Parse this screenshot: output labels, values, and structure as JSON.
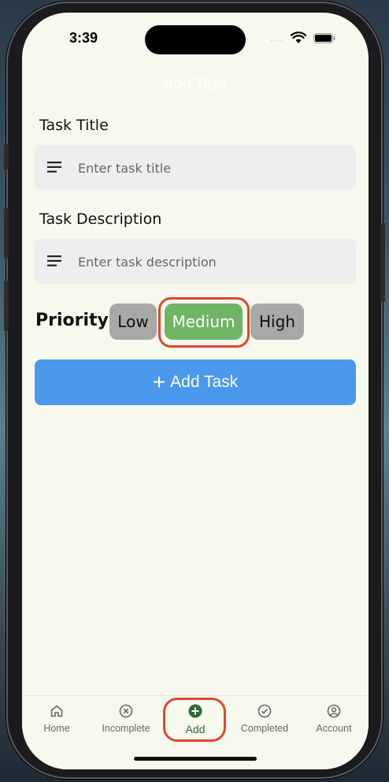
{
  "status_bar": {
    "time": "3:39",
    "signal": "....",
    "icons": [
      "wifi-icon",
      "battery-icon"
    ]
  },
  "header": {
    "title": "Add Task"
  },
  "form": {
    "title_label": "Task Title",
    "title_placeholder": "Enter task title",
    "description_label": "Task Description",
    "description_placeholder": "Enter task description",
    "priority_label": "Priority",
    "priorities": [
      {
        "label": "Low",
        "selected": false
      },
      {
        "label": "Medium",
        "selected": true
      },
      {
        "label": "High",
        "selected": false
      }
    ],
    "submit_label": "Add Task",
    "submit_icon": "+"
  },
  "bottom_nav": {
    "items": [
      {
        "label": "Home",
        "icon": "home-icon",
        "active": false
      },
      {
        "label": "Incomplete",
        "icon": "x-circle-icon",
        "active": false
      },
      {
        "label": "Add",
        "icon": "add-circle-icon",
        "active": true
      },
      {
        "label": "Completed",
        "icon": "check-circle-icon",
        "active": false
      },
      {
        "label": "Account",
        "icon": "account-icon",
        "active": false
      }
    ]
  },
  "colors": {
    "background": "#f7f9ef",
    "accent_green": "#6fb565",
    "accent_blue": "#4a98ec",
    "chip_gray": "#a8a8a8",
    "highlight_red": "#e0472b",
    "active_nav": "#2e6b2f"
  }
}
